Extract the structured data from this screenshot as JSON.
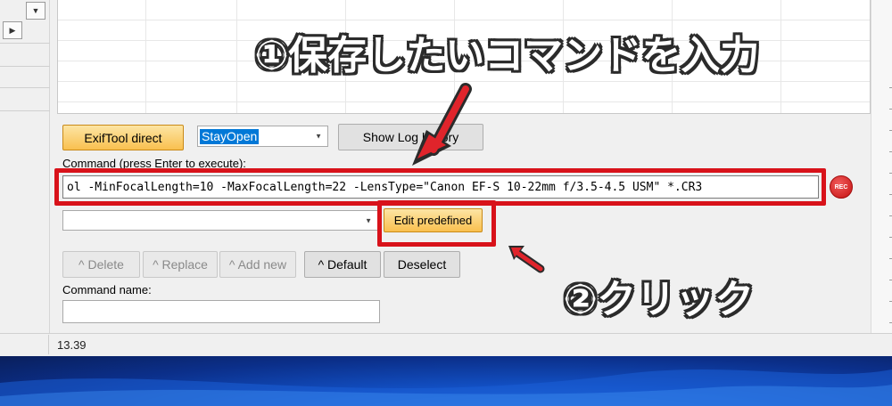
{
  "toolbar": {
    "exiftool_direct_label": "ExifTool direct",
    "mode_select_value": "StayOpen",
    "show_log_label": "Show Log history"
  },
  "command": {
    "label": "Command (press Enter to execute):",
    "value": "ol -MinFocalLength=10 -MaxFocalLength=22 -LensType=\"Canon EF-S 10-22mm f/3.5-4.5 USM\" *.CR3",
    "rec_label": "REC"
  },
  "predefined": {
    "select_value": "",
    "edit_label": "Edit predefined"
  },
  "actions": {
    "delete_label": "^ Delete",
    "replace_label": "^ Replace",
    "add_new_label": "^ Add new",
    "default_label": "^ Default",
    "deselect_label": "Deselect"
  },
  "name_field": {
    "label": "Command name:",
    "value": ""
  },
  "status": {
    "text": "13.39"
  },
  "annotations": {
    "step1": "①保存したいコマンドを入力",
    "step2": "②クリック"
  },
  "colors": {
    "highlight_red": "#d8121a",
    "annotation_arrow": "#e0242b",
    "orange_button": "#f9c04f",
    "selection_blue": "#0078d7"
  }
}
